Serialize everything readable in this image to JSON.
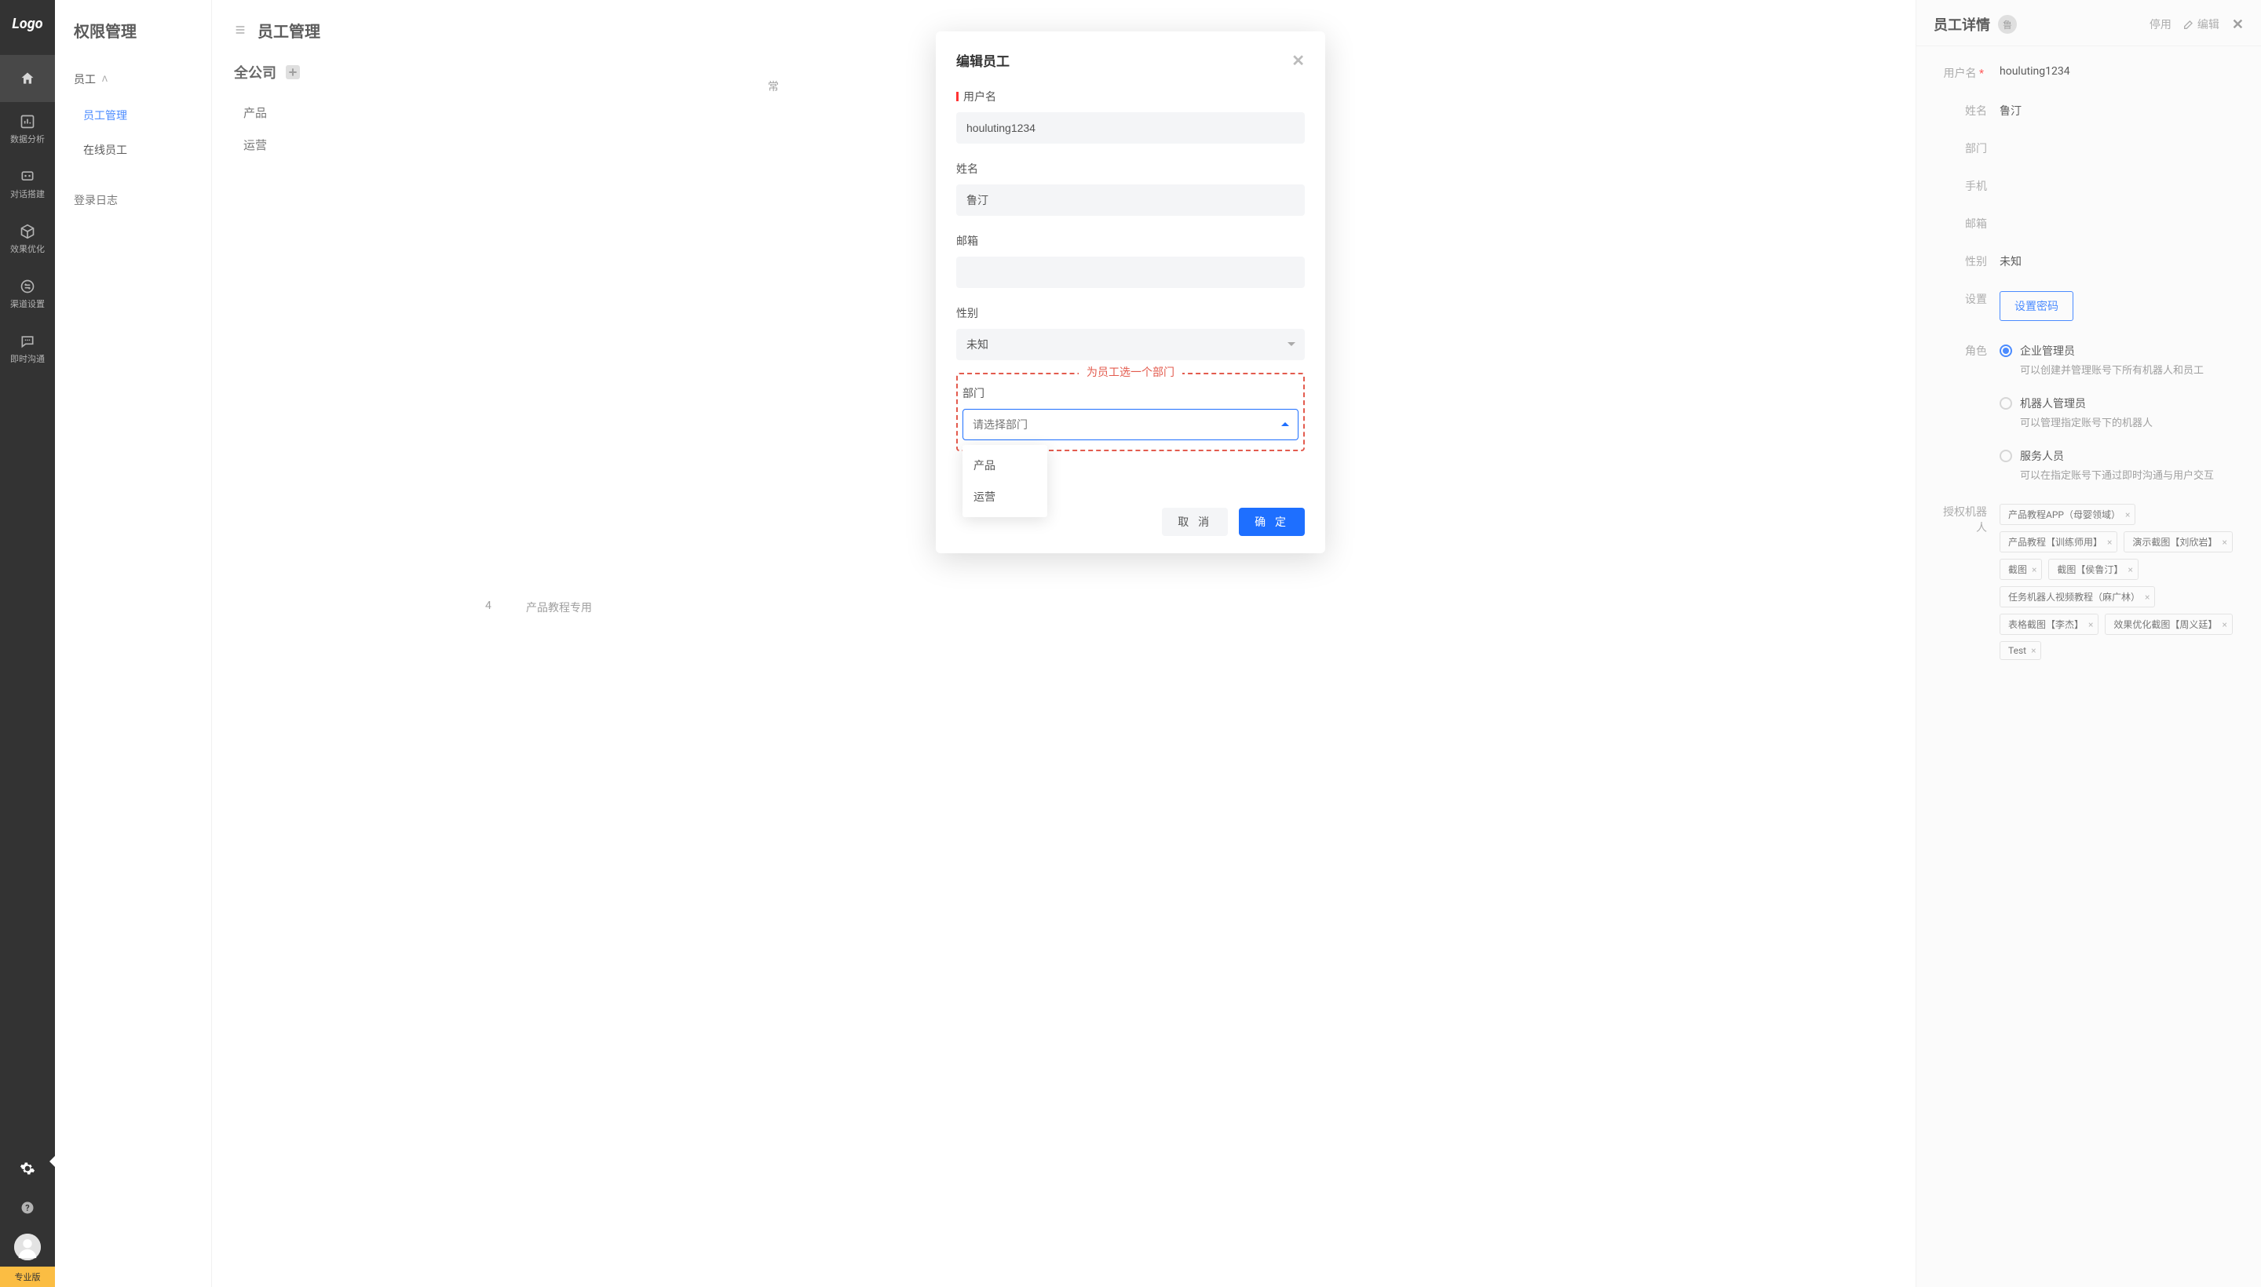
{
  "logo": "Logo",
  "navRail": {
    "items": [
      {
        "label": ""
      },
      {
        "label": "数据分析"
      },
      {
        "label": "对话搭建"
      },
      {
        "label": "效果优化"
      },
      {
        "label": "渠道设置"
      },
      {
        "label": "即时沟通"
      }
    ],
    "pro": "专业版"
  },
  "sidebar": {
    "title": "权限管理",
    "section1": "员工",
    "sub1": "员工管理",
    "sub2": "在线员工",
    "section2": "登录日志"
  },
  "main": {
    "header": "员工管理",
    "company": "全公司",
    "depts": [
      "产品",
      "运营"
    ],
    "bg1": "常",
    "bg2": "4",
    "bg3": "产品教程专用"
  },
  "modal": {
    "title": "编辑员工",
    "fields": {
      "username_label": "用户名",
      "username_value": "houluting1234",
      "name_label": "姓名",
      "name_value": "鲁汀",
      "email_label": "邮箱",
      "email_value": "",
      "gender_label": "性别",
      "gender_value": "未知",
      "dept_label": "部门",
      "dept_placeholder": "请选择部门"
    },
    "callout": "为员工选一个部门",
    "dropdown": [
      "产品",
      "运营"
    ],
    "cancel": "取 消",
    "confirm": "确 定"
  },
  "detail": {
    "title": "员工详情",
    "avatarChar": "鲁",
    "disable": "停用",
    "edit": "编辑",
    "rows": {
      "username_label": "用户名",
      "username_value": "houluting1234",
      "name_label": "姓名",
      "name_value": "鲁汀",
      "dept_label": "部门",
      "phone_label": "手机",
      "email_label": "邮箱",
      "gender_label": "性别",
      "gender_value": "未知",
      "settings_label": "设置",
      "set_password": "设置密码",
      "role_label": "角色",
      "bots_label": "授权机器人"
    },
    "roles": [
      {
        "name": "企业管理员",
        "desc": "可以创建并管理账号下所有机器人和员工"
      },
      {
        "name": "机器人管理员",
        "desc": "可以管理指定账号下的机器人"
      },
      {
        "name": "服务人员",
        "desc": "可以在指定账号下通过即时沟通与用户交互"
      }
    ],
    "tags": [
      "产品教程APP（母婴领域）",
      "产品教程【训练师用】",
      "演示截图【刘欣岩】",
      "截图",
      "截图【侯鲁汀】",
      "任务机器人视频教程（麻广林）",
      "表格截图【李杰】",
      "效果优化截图【周义廷】",
      "Test"
    ]
  }
}
